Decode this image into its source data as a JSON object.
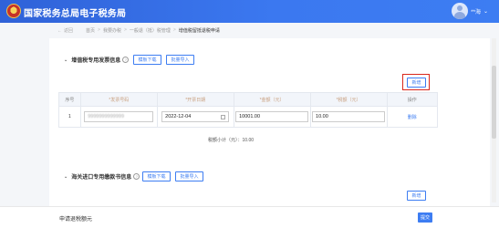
{
  "app": {
    "title": "国家税务总局电子税务局",
    "user_name": "**海",
    "user_chevron": "⌄"
  },
  "breadcrumb": {
    "back_label": "返回",
    "items": [
      "首页",
      "我要办税",
      "一般退（抵）税管理",
      "增值税留抵退税申请"
    ]
  },
  "section1": {
    "title": "增值税专用发票信息",
    "template_download": "模板下载",
    "batch_import": "批量导入",
    "add_label": "新增",
    "table": {
      "headers": [
        "序号",
        "*发票号码",
        "*开票日期",
        "*金额（元）",
        "*税额（元）",
        "操作"
      ],
      "rows": [
        {
          "index": "1",
          "invoice_no": "9999999999999",
          "date": "2022-12-04",
          "amount": "10001.00",
          "tax": "10.00",
          "action": "删除"
        }
      ]
    },
    "subtotal": "税额小计（元）：10.00"
  },
  "section2": {
    "title": "海关进口专用缴款书信息",
    "template_download": "模板下载",
    "batch_import": "批量导入",
    "add_label": "新增"
  },
  "footer": {
    "refund_label": "申请退税额",
    "unit": "元",
    "submit_label": "提交"
  },
  "colors": {
    "brand_blue": "#3d7df2",
    "highlight_red": "#d9281c"
  }
}
